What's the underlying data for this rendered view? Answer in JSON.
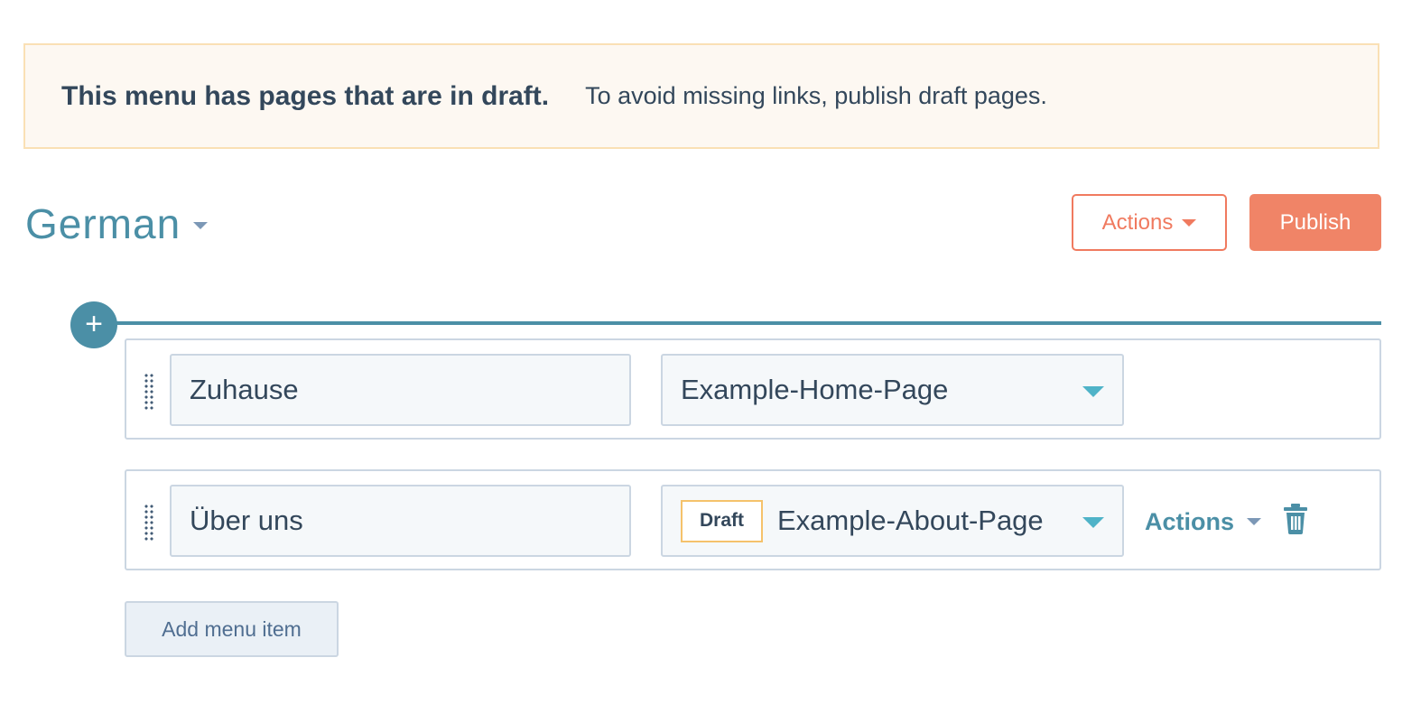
{
  "alert": {
    "title": "This menu has pages that are in draft.",
    "body": "To avoid missing links, publish draft pages."
  },
  "language": {
    "selected": "German",
    "icon": "chevron-down-icon"
  },
  "header": {
    "actions_label": "Actions",
    "publish_label": "Publish"
  },
  "menu_items": [
    {
      "label": "Zuhause",
      "page": "Example-Home-Page",
      "status": ""
    },
    {
      "label": "Über uns",
      "page": "Example-About-Page",
      "status": "Draft",
      "actions_label": "Actions"
    }
  ],
  "add_item_label": "Add menu item",
  "colors": {
    "accent": "#4b8fa6",
    "primary_button": "#f08467",
    "draft_badge_border": "#f5c26b",
    "alert_background": "#fdf8f2"
  }
}
